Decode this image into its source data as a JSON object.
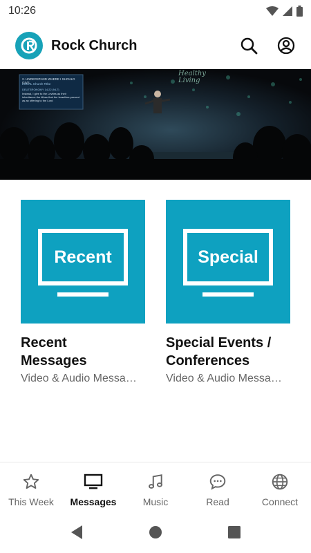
{
  "status": {
    "time": "10:26",
    "icons": [
      "wifi-icon",
      "signal-icon",
      "battery-icon"
    ]
  },
  "app_bar": {
    "title": "Rock Church",
    "logo": "rock-church-logo",
    "actions": [
      "search-icon",
      "account-icon"
    ]
  },
  "hero": {
    "slide_heading": "2. UNDERSTAND WHERE I SHOULD GIVE.",
    "slide_sub": "LOCAL Church Tithe",
    "slide_quote_ref": "DEUTERONOMY 14:22 (NLT)",
    "slide_body": "Instead, I give to the Levites as their inheritance the tithes that the Israelites present as an offering to the Lord",
    "series_title": "Healthy Living"
  },
  "cards": [
    {
      "thumb_text": "Recent",
      "title_line1": "Recent",
      "title_line2": "Messages",
      "subtitle": "Video & Audio Messages"
    },
    {
      "thumb_text": "Special",
      "title_line1": "Special Events /",
      "title_line2": "Conferences",
      "subtitle": "Video & Audio Messages"
    }
  ],
  "bottom_nav": {
    "items": [
      {
        "label": "This Week",
        "icon": "star-icon",
        "active": false
      },
      {
        "label": "Messages",
        "icon": "tv-icon",
        "active": true
      },
      {
        "label": "Music",
        "icon": "music-note-icon",
        "active": false
      },
      {
        "label": "Read",
        "icon": "chat-bubble-icon",
        "active": false
      },
      {
        "label": "Connect",
        "icon": "globe-icon",
        "active": false
      }
    ]
  },
  "system_nav": [
    "back-icon",
    "home-icon",
    "recents-icon"
  ],
  "colors": {
    "accent": "#0ea1c0",
    "logo": "#17a2b8",
    "text_primary": "#111111",
    "text_secondary": "#666666"
  }
}
